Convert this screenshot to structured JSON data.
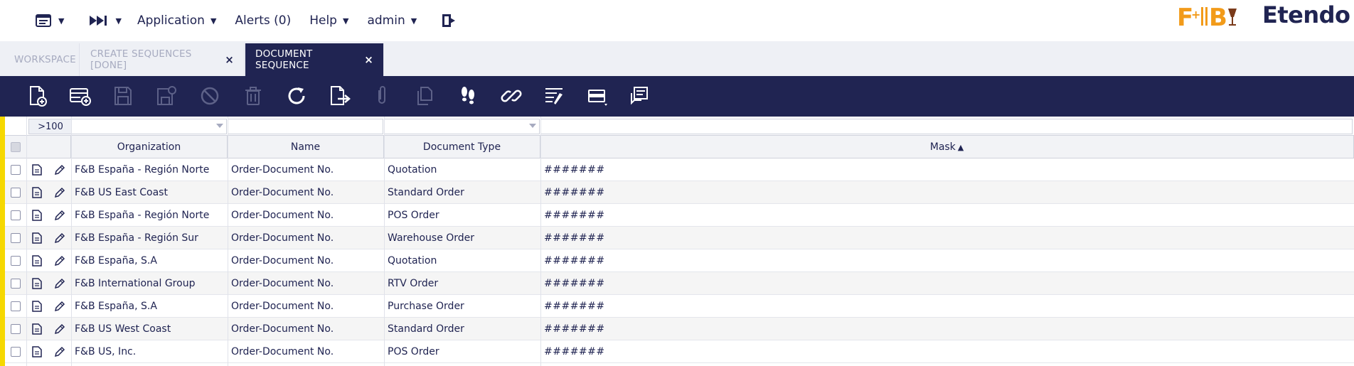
{
  "topnav": {
    "application": "Application",
    "alerts": "Alerts (0)",
    "help": "Help",
    "user": "admin"
  },
  "brand": {
    "fb_logo": "F+IB",
    "app_logo": "Etendo",
    "colors": {
      "navy": "#202452",
      "accent_orange": "#f29b1a",
      "selection_yellow": "#f6d800"
    }
  },
  "tabs": [
    {
      "label": "WORKSPACE",
      "closable": false,
      "active": false
    },
    {
      "label": "CREATE SEQUENCES [DONE]",
      "closable": true,
      "active": false
    },
    {
      "label": "DOCUMENT SEQUENCE",
      "closable": true,
      "active": true
    }
  ],
  "tab_close_glyph": "×",
  "toolbar": {
    "buttons": [
      {
        "icon": "new-document-icon",
        "enabled": true
      },
      {
        "icon": "new-row-icon",
        "enabled": true
      },
      {
        "icon": "save-icon",
        "enabled": false
      },
      {
        "icon": "save-close-icon",
        "enabled": false
      },
      {
        "icon": "cancel-icon",
        "enabled": false
      },
      {
        "icon": "delete-icon",
        "enabled": false
      },
      {
        "icon": "refresh-icon",
        "enabled": true
      },
      {
        "icon": "export-icon",
        "enabled": true
      },
      {
        "icon": "attachment-icon",
        "enabled": false
      },
      {
        "icon": "clone-icon",
        "enabled": false
      },
      {
        "icon": "audit-trail-icon",
        "enabled": true
      },
      {
        "icon": "link-icon",
        "enabled": true
      },
      {
        "icon": "filter-columns-icon",
        "enabled": true
      },
      {
        "icon": "grid-view-icon",
        "enabled": true
      },
      {
        "icon": "notes-icon",
        "enabled": true
      }
    ]
  },
  "grid": {
    "record_count": ">100",
    "columns": [
      "Organization",
      "Name",
      "Document Type",
      "Mask"
    ],
    "sorted_column": "Mask",
    "sort_glyph": "▲",
    "rows": [
      {
        "organization": "F&B España - Región Norte",
        "name": "Order-Document No.",
        "document_type": "Quotation",
        "mask": "#######"
      },
      {
        "organization": "F&B US East Coast",
        "name": "Order-Document No.",
        "document_type": "Standard Order",
        "mask": "#######"
      },
      {
        "organization": "F&B España - Región Norte",
        "name": "Order-Document No.",
        "document_type": "POS Order",
        "mask": "#######"
      },
      {
        "organization": "F&B España - Región Sur",
        "name": "Order-Document No.",
        "document_type": "Warehouse Order",
        "mask": "#######"
      },
      {
        "organization": "F&B España, S.A",
        "name": "Order-Document No.",
        "document_type": "Quotation",
        "mask": "#######"
      },
      {
        "organization": "F&B International Group",
        "name": "Order-Document No.",
        "document_type": "RTV Order",
        "mask": "#######"
      },
      {
        "organization": "F&B España, S.A",
        "name": "Order-Document No.",
        "document_type": "Purchase Order",
        "mask": "#######"
      },
      {
        "organization": "F&B US West Coast",
        "name": "Order-Document No.",
        "document_type": "Standard Order",
        "mask": "#######"
      },
      {
        "organization": "F&B US, Inc.",
        "name": "Order-Document No.",
        "document_type": "POS Order",
        "mask": "#######"
      }
    ]
  }
}
